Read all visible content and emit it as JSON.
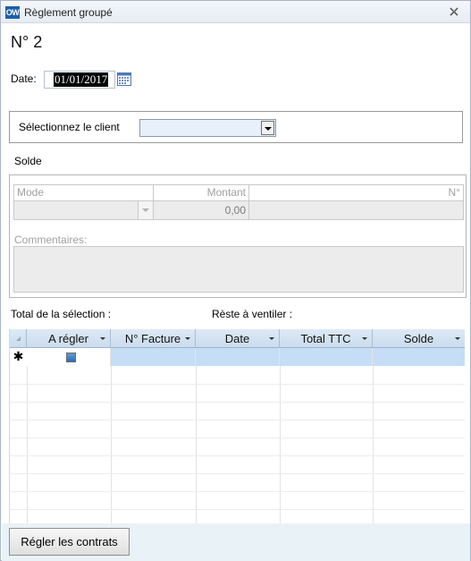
{
  "window": {
    "title": "Règlement groupé",
    "app_icon_text": "OW"
  },
  "form": {
    "number": "N° 2"
  },
  "date": {
    "label": "Date:",
    "value": "01/01/2017"
  },
  "client": {
    "label": "Sélectionnez le client",
    "selected": ""
  },
  "solde": {
    "label": "Solde",
    "columns": {
      "mode": "Mode",
      "montant": "Montant",
      "numero": "N°"
    },
    "values": {
      "mode": "",
      "montant": "0,00",
      "numero": ""
    },
    "comments_label": "Commentaires:",
    "comments_value": ""
  },
  "totals": {
    "selection_label": "Total de la sélection :",
    "reste_label": "Rèste à ventiler :"
  },
  "grid": {
    "columns": [
      "A régler",
      "N° Facture",
      "Date",
      "Total TTC",
      "Solde"
    ],
    "new_row_marker": "✱"
  },
  "footer": {
    "button_label": "Régler les contrats"
  }
}
